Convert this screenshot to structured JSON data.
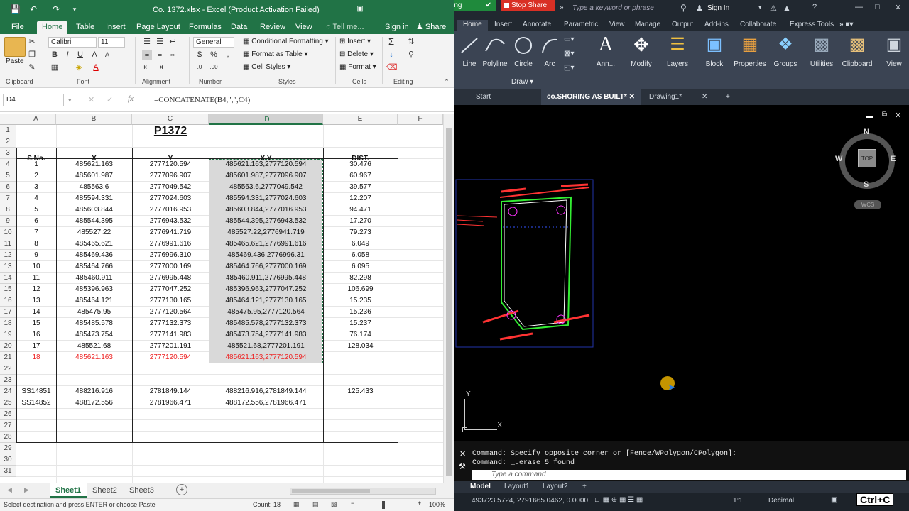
{
  "excel": {
    "title": "Co. 1372.xlsx - Excel (Product Activation Failed)",
    "tabs": [
      "File",
      "Home",
      "Table",
      "Insert",
      "Page Layout",
      "Formulas",
      "Data",
      "Review",
      "View"
    ],
    "tell_me": "Tell me...",
    "sign_in": "Sign in",
    "share": "Share",
    "ribbon": {
      "paste": "Paste",
      "font_name": "Calibri",
      "font_size": "11",
      "number_format": "General",
      "cond_format": "Conditional Formatting",
      "format_table": "Format as Table",
      "cell_styles": "Cell Styles",
      "insert": "Insert",
      "delete": "Delete",
      "format": "Format",
      "groups": [
        "Clipboard",
        "Font",
        "Alignment",
        "Number",
        "Styles",
        "Cells",
        "Editing"
      ]
    },
    "name_box": "D4",
    "formula": "=CONCATENATE(B4,\",\",C4)",
    "columns": [
      "A",
      "B",
      "C",
      "D",
      "E",
      "F"
    ],
    "title_cell": "P1372",
    "headers": [
      "S.No.",
      "X",
      "Y",
      "X,Y",
      "DIST."
    ],
    "rows": [
      {
        "r": "4",
        "sno": "1",
        "x": "485621.163",
        "y": "2777120.594",
        "xy": "485621.163,2777120.594",
        "dist": "30.476"
      },
      {
        "r": "5",
        "sno": "2",
        "x": "485601.987",
        "y": "2777096.907",
        "xy": "485601.987,2777096.907",
        "dist": "60.967"
      },
      {
        "r": "6",
        "sno": "3",
        "x": "485563.6",
        "y": "2777049.542",
        "xy": "485563.6,2777049.542",
        "dist": "39.577"
      },
      {
        "r": "7",
        "sno": "4",
        "x": "485594.331",
        "y": "2777024.603",
        "xy": "485594.331,2777024.603",
        "dist": "12.207"
      },
      {
        "r": "8",
        "sno": "5",
        "x": "485603.844",
        "y": "2777016.953",
        "xy": "485603.844,2777016.953",
        "dist": "94.471"
      },
      {
        "r": "9",
        "sno": "6",
        "x": "485544.395",
        "y": "2776943.532",
        "xy": "485544.395,2776943.532",
        "dist": "17.270"
      },
      {
        "r": "10",
        "sno": "7",
        "x": "485527.22",
        "y": "2776941.719",
        "xy": "485527.22,2776941.719",
        "dist": "79.273"
      },
      {
        "r": "11",
        "sno": "8",
        "x": "485465.621",
        "y": "2776991.616",
        "xy": "485465.621,2776991.616",
        "dist": "6.049"
      },
      {
        "r": "12",
        "sno": "9",
        "x": "485469.436",
        "y": "2776996.310",
        "xy": "485469.436,2776996.31",
        "dist": "6.058"
      },
      {
        "r": "13",
        "sno": "10",
        "x": "485464.766",
        "y": "2777000.169",
        "xy": "485464.766,2777000.169",
        "dist": "6.095"
      },
      {
        "r": "14",
        "sno": "11",
        "x": "485460.911",
        "y": "2776995.448",
        "xy": "485460.911,2776995.448",
        "dist": "82.298"
      },
      {
        "r": "15",
        "sno": "12",
        "x": "485396.963",
        "y": "2777047.252",
        "xy": "485396.963,2777047.252",
        "dist": "106.699"
      },
      {
        "r": "16",
        "sno": "13",
        "x": "485464.121",
        "y": "2777130.165",
        "xy": "485464.121,2777130.165",
        "dist": "15.235"
      },
      {
        "r": "17",
        "sno": "14",
        "x": "485475.95",
        "y": "2777120.564",
        "xy": "485475.95,2777120.564",
        "dist": "15.236"
      },
      {
        "r": "18",
        "sno": "15",
        "x": "485485.578",
        "y": "2777132.373",
        "xy": "485485.578,2777132.373",
        "dist": "15.237"
      },
      {
        "r": "19",
        "sno": "16",
        "x": "485473.754",
        "y": "2777141.983",
        "xy": "485473.754,2777141.983",
        "dist": "76.174"
      },
      {
        "r": "20",
        "sno": "17",
        "x": "485521.68",
        "y": "2777201.191",
        "xy": "485521.68,2777201.191",
        "dist": "128.034"
      },
      {
        "r": "21",
        "sno": "18",
        "x": "485621.163",
        "y": "2777120.594",
        "xy": "485621.163,2777120.594",
        "dist": ""
      }
    ],
    "extra_rows": [
      {
        "r": "24",
        "sno": "SS14851",
        "x": "488216.916",
        "y": "2781849.144",
        "xy": "488216.916,2781849.144",
        "dist": "125.433"
      },
      {
        "r": "25",
        "sno": "SS14852",
        "x": "488172.556",
        "y": "2781966.471",
        "xy": "488172.556,2781966.471",
        "dist": ""
      }
    ],
    "sheets": [
      "Sheet1",
      "Sheet2",
      "Sheet3"
    ],
    "status_text": "Select destination and press ENTER or choose Paste",
    "count": "Count: 18",
    "zoom": "100%"
  },
  "autocad": {
    "screen_sharing": "You are screen sharing",
    "stop_share": "Stop Share",
    "search_placeholder": "Type a keyword or phrase",
    "sign_in": "Sign In",
    "tabs": [
      "Home",
      "Insert",
      "Annotate",
      "Parametric",
      "View",
      "Manage",
      "Output",
      "Add-ins",
      "Collaborate",
      "Express Tools"
    ],
    "tools": [
      "Line",
      "Polyline",
      "Circle",
      "Arc",
      "Ann...",
      "Modify",
      "Layers",
      "Block",
      "Properties",
      "Groups",
      "Utilities",
      "Clipboard",
      "View"
    ],
    "draw_panel": "Draw",
    "doc_tabs": [
      "Start",
      "co.SHORING AS BUILT*",
      "Drawing1*"
    ],
    "viewcube": {
      "n": "N",
      "s": "S",
      "e": "E",
      "w": "W",
      "top": "TOP",
      "wcs": "WCS"
    },
    "ucs": {
      "x": "X",
      "y": "Y"
    },
    "cmd_lines": [
      "Command: Specify opposite corner or [Fence/WPolygon/CPolygon]:",
      "Command: _.erase 5 found"
    ],
    "cmd_placeholder": "Type a command",
    "layout_tabs": [
      "Model",
      "Layout1",
      "Layout2"
    ],
    "coords": "493723.5724, 2791665.0462, 0.0000",
    "model_label": "MODEL",
    "units": "Decimal",
    "scale": "1:1",
    "keystroke": "Ctrl+C"
  }
}
